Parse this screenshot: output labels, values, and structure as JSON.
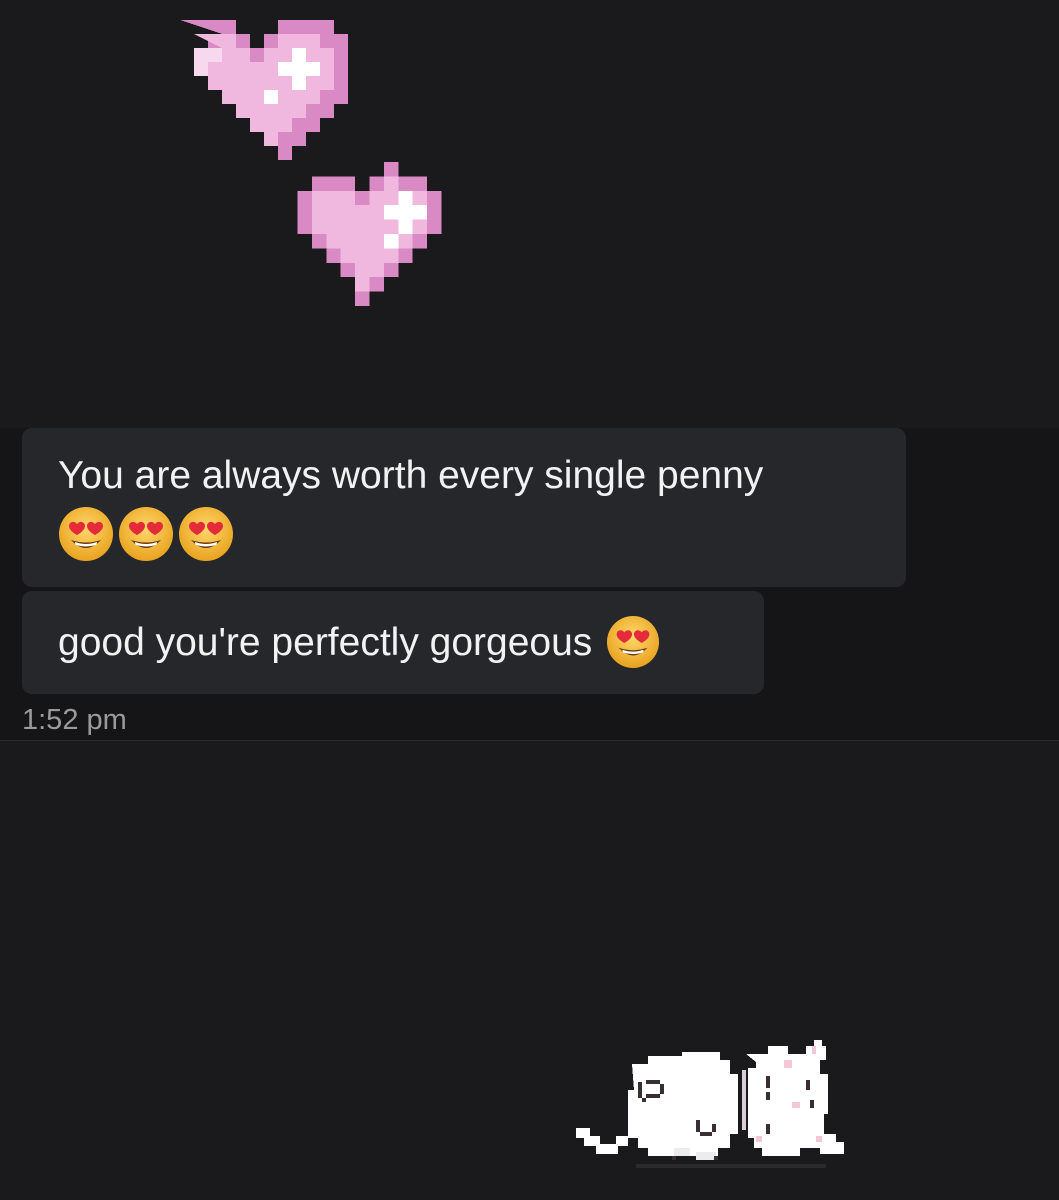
{
  "messages": [
    {
      "text": "You are always worth every single penny",
      "emojis": [
        "heart-eyes-emoji",
        "heart-eyes-emoji",
        "heart-eyes-emoji"
      ]
    },
    {
      "text": "good you're perfectly gorgeous",
      "emojis": [
        "heart-eyes-emoji"
      ]
    }
  ],
  "timestamp": "1:52 pm",
  "stickers": [
    "pixel-heart",
    "pixel-heart",
    "sleeping-cat"
  ],
  "colors": {
    "background": "#1a191b",
    "chat_band": "#151517",
    "bubble": "#26272a",
    "text": "#f2f2f2",
    "timestamp": "#9a9a9d",
    "heart_pink": "#f0b8de"
  }
}
